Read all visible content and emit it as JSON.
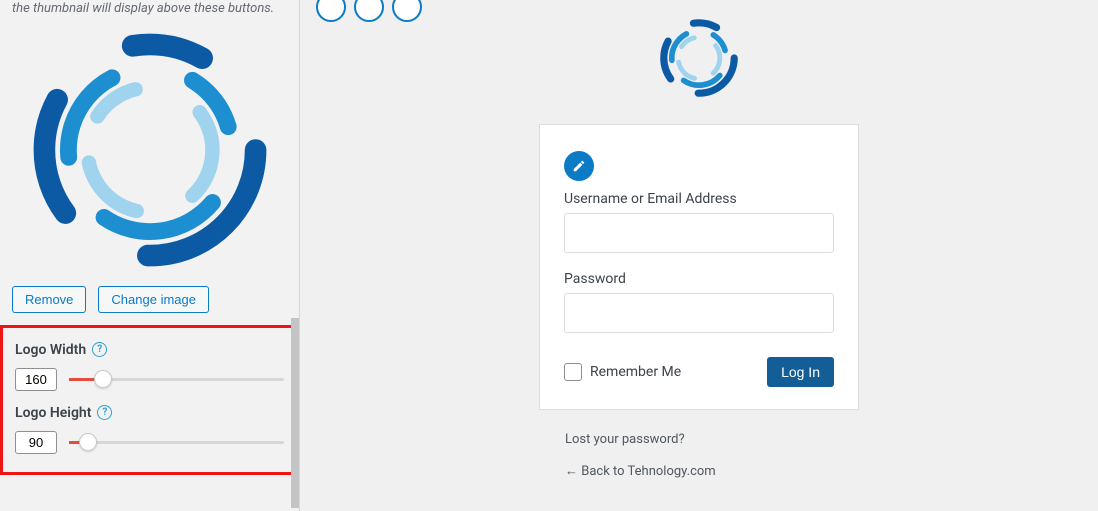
{
  "panel": {
    "helper": "the thumbnail will display above these buttons.",
    "remove_label": "Remove",
    "change_label": "Change image",
    "width_label": "Logo Width",
    "height_label": "Logo Height",
    "help_glyph": "?",
    "width_value": "160",
    "height_value": "90",
    "width_pct": 16,
    "height_pct": 9
  },
  "login": {
    "username_label": "Username or Email Address",
    "password_label": "Password",
    "remember_label": "Remember Me",
    "submit_label": "Log In",
    "lost_label": "Lost your password?",
    "back_label": "← Back to Tehnology.com"
  }
}
